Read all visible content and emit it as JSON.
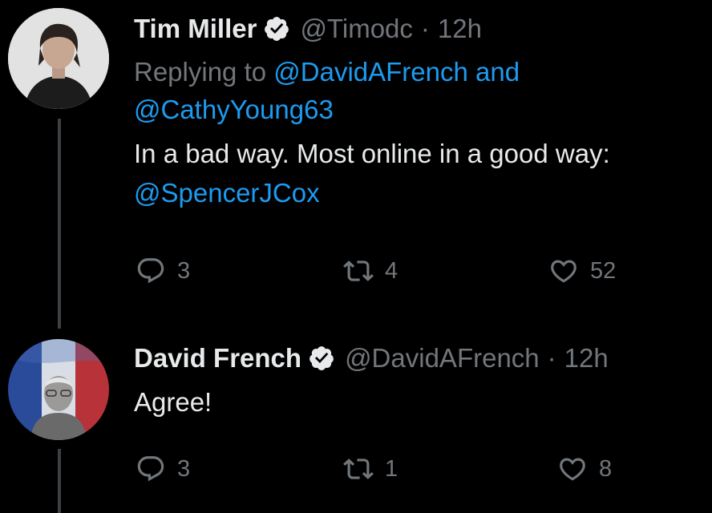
{
  "tweets": [
    {
      "author_name": "Tim Miller",
      "handle": "@Timodc",
      "separator": "·",
      "time": "12h",
      "reply_prefix": "Replying to ",
      "reply_user1": "@DavidAFrench",
      "reply_and": " and",
      "reply_user2": "@CathyYoung63",
      "text": "In a bad way. Most online in a good way:",
      "mention": "@SpencerJCox",
      "replies": "3",
      "retweets": "4",
      "likes": "52"
    },
    {
      "author_name": "David French",
      "handle": "@DavidAFrench",
      "separator": "·",
      "time": "12h",
      "text": "Agree!",
      "replies": "3",
      "retweets": "1",
      "likes": "8"
    }
  ],
  "colors": {
    "background": "#000000",
    "text": "#e7e9ea",
    "muted": "#71767b",
    "link": "#1d9bf0"
  }
}
